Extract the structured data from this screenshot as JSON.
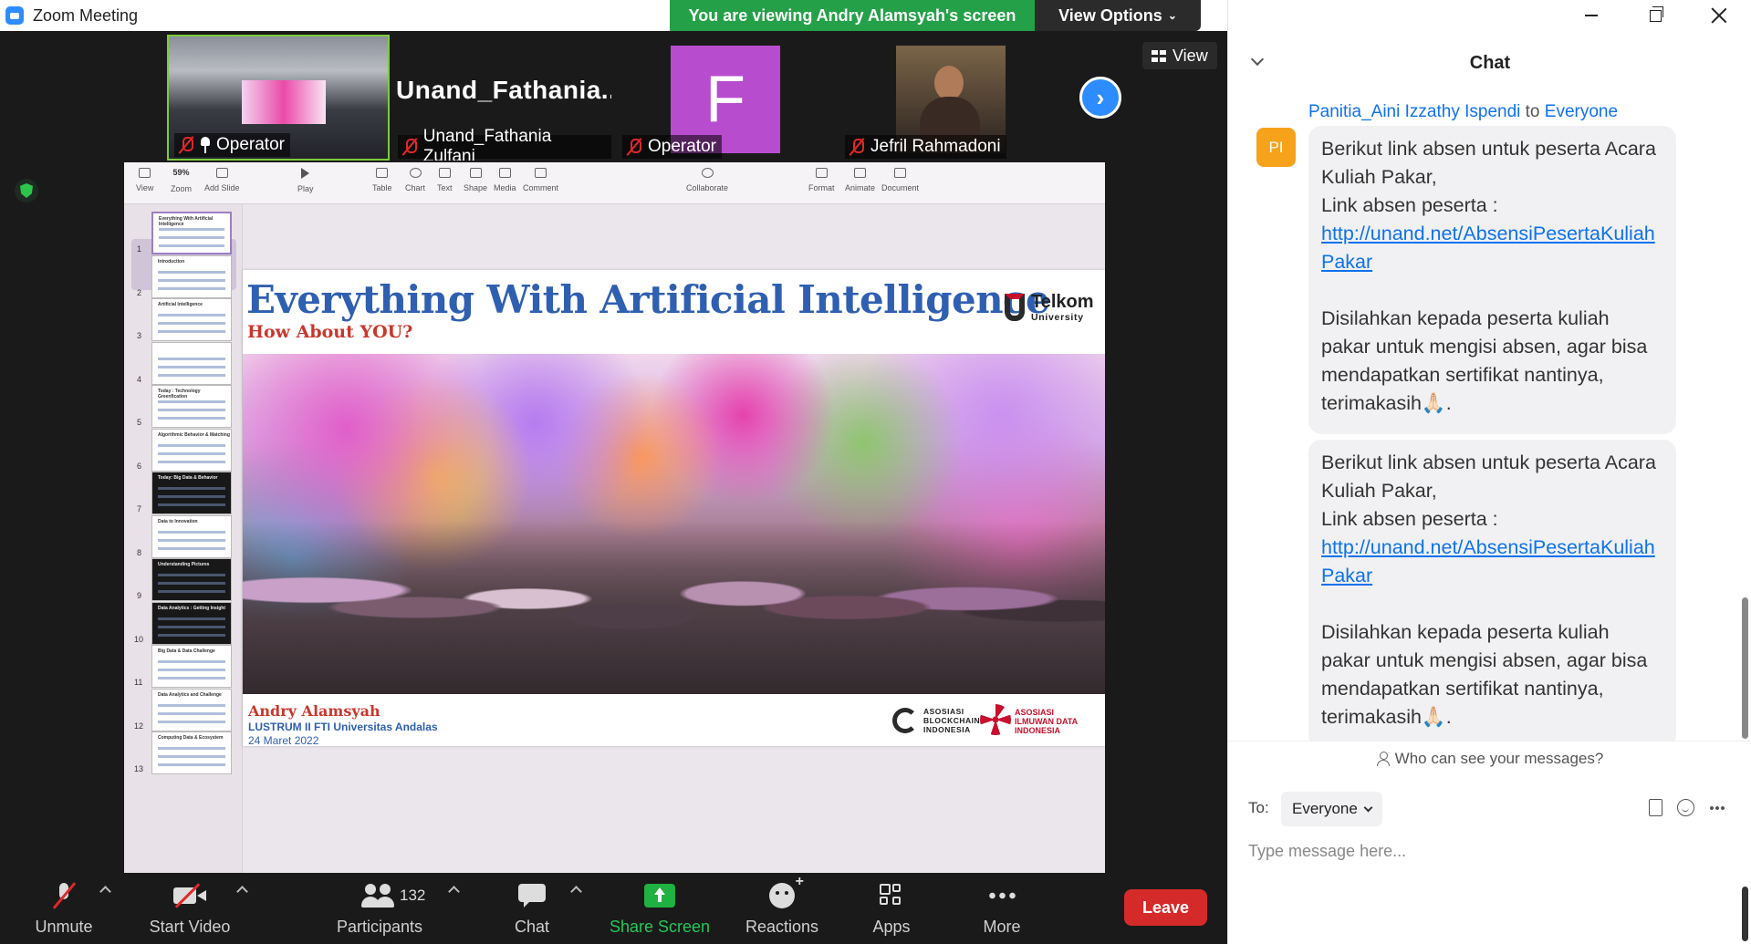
{
  "app": {
    "title": "Zoom Meeting"
  },
  "banner": {
    "viewing": "You are viewing Andry Alamsyah's screen",
    "view_options": "View Options"
  },
  "filmstrip": {
    "view_label": "View",
    "tiles": [
      {
        "name": "Operator"
      },
      {
        "name": "Unand_Fathania Zulfani",
        "display": "Unand_Fathania..."
      },
      {
        "name": "Operator",
        "avatar_letter": "F"
      },
      {
        "name": "Jefril Rahmadoni"
      }
    ]
  },
  "keynote": {
    "zoom": "59%",
    "tools": [
      "View",
      "Zoom",
      "Add Slide",
      "Play",
      "Table",
      "Chart",
      "Text",
      "Shape",
      "Media",
      "Comment",
      "Collaborate",
      "Format",
      "Animate",
      "Document"
    ],
    "thumbnails": [
      {
        "num": "1",
        "title": "Everything With Artificial Intelligence",
        "dark": false
      },
      {
        "num": "2",
        "title": "Introduction",
        "dark": false
      },
      {
        "num": "3",
        "title": "Artificial Intelligence",
        "dark": false
      },
      {
        "num": "4",
        "title": "",
        "dark": false
      },
      {
        "num": "5",
        "title": "Today : Technology Greenfication",
        "dark": false
      },
      {
        "num": "6",
        "title": "Algorithmic Behavior & Matching",
        "dark": false
      },
      {
        "num": "7",
        "title": "Today: Big Data & Behavior",
        "dark": true
      },
      {
        "num": "8",
        "title": "Data to Innovation",
        "dark": false
      },
      {
        "num": "9",
        "title": "Understanding Pictures",
        "dark": true
      },
      {
        "num": "10",
        "title": "Data Analytics : Getting Insight",
        "dark": true
      },
      {
        "num": "11",
        "title": "Big Data & Data Challenge",
        "dark": false
      },
      {
        "num": "12",
        "title": "Data Analytics and Challenge",
        "dark": false
      },
      {
        "num": "13",
        "title": "Computing Data & Ecosystem",
        "dark": false
      }
    ],
    "slide": {
      "title": "Everything With Artificial Intelligence",
      "subtitle": "How About YOU?",
      "logo_main": "Telkom",
      "logo_sub": "University",
      "presenter": "Andry Alamsyah",
      "event": "LUSTRUM II FTI Universitas Andalas",
      "date": "24 Maret 2022",
      "partner1": "ASOSIASI BLOCKCHAIN INDONESIA",
      "partner2": "ASOSIASI ILMUWAN DATA INDONESIA"
    }
  },
  "toolbar": {
    "unmute": "Unmute",
    "start_video": "Start Video",
    "participants": "Participants",
    "participant_count": "132",
    "chat": "Chat",
    "share_screen": "Share Screen",
    "reactions": "Reactions",
    "apps": "Apps",
    "more": "More",
    "leave": "Leave"
  },
  "chat": {
    "title": "Chat",
    "sender": "Panitia_Aini Izzathy Ispendi",
    "to_word": "to",
    "recipient": "Everyone",
    "avatar_initials": "PI",
    "messages": [
      {
        "line1": "Berikut link absen untuk peserta Acara Kuliah Pakar,",
        "line2": "Link absen peserta :",
        "link": "http://unand.net/AbsensiPesertaKuliahPakar",
        "line3": "Disilahkan kepada peserta kuliah pakar untuk mengisi absen, agar bisa mendapatkan sertifikat nantinya, terimakasih🙏🏻."
      },
      {
        "line1": "Berikut link absen untuk peserta Acara Kuliah Pakar,",
        "line2": "Link absen peserta :",
        "link": "http://unand.net/AbsensiPesertaKuliahPakar",
        "line3": "Disilahkan kepada peserta kuliah pakar untuk mengisi absen, agar bisa mendapatkan sertifikat nantinya, terimakasih🙏🏻."
      }
    ],
    "who_can_see": "Who can see your messages?",
    "to_label": "To:",
    "to_value": "Everyone",
    "placeholder": "Type message here..."
  }
}
